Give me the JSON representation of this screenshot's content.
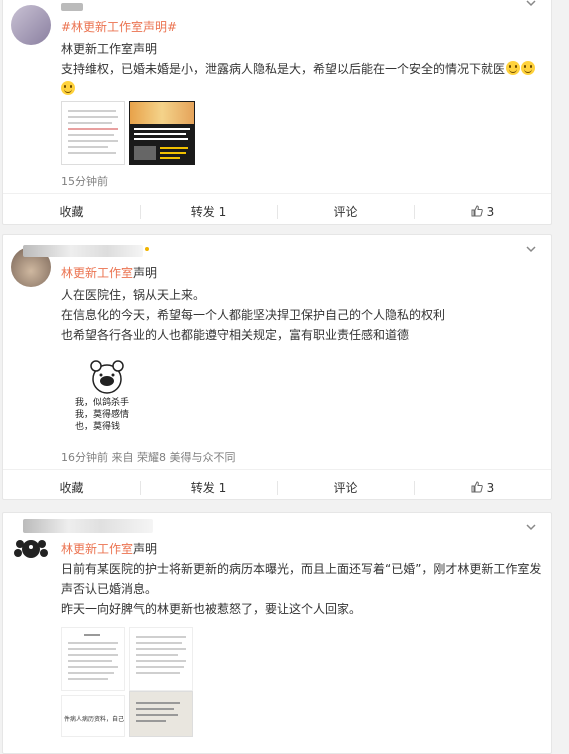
{
  "posts": [
    {
      "topic": "#林更新工作室声明#",
      "lines": [
        "林更新工作室声明",
        "支持维权，已婚未婚是小，泄露病人隐私是大，希望以后能在一个安全的情况下就医"
      ],
      "time": "15分钟前",
      "actions": {
        "fav": "收藏",
        "repost": "转发 1",
        "comment": "评论",
        "like": "3"
      }
    },
    {
      "username_tag": "",
      "header_link": "林更新工作室",
      "header_suffix": "声明",
      "lines": [
        "人在医院住，锅从天上来。",
        "在信息化的今天，希望每一个人都能坚决捍卫保护自己的个人隐私的权利",
        "也希望各行各业的人也都能遵守相关规定，富有职业责任感和道德"
      ],
      "meme_lines": [
        "我，似鸽杀手",
        "我，莫得感情",
        "也，莫得钱"
      ],
      "meta": "16分钟前 来自 荣耀8 美得与众不同",
      "actions": {
        "fav": "收藏",
        "repost": "转发 1",
        "comment": "评论",
        "like": "3"
      }
    },
    {
      "header_link": "林更新工作室",
      "header_suffix": "声明",
      "lines": [
        "日前有某医院的护士将新更新的病历本曝光，而且上面还写着“已婚”，刚才林更新工作室发",
        "声否认已婚消息。",
        "昨天一向好脾气的林更新也被惹怒了，要让这个人回家。"
      ],
      "doc_caption": "件病人病历资料，自己的病情"
    }
  ],
  "colors": {
    "link": "#eb7350",
    "bg": "#f2f2f2"
  }
}
